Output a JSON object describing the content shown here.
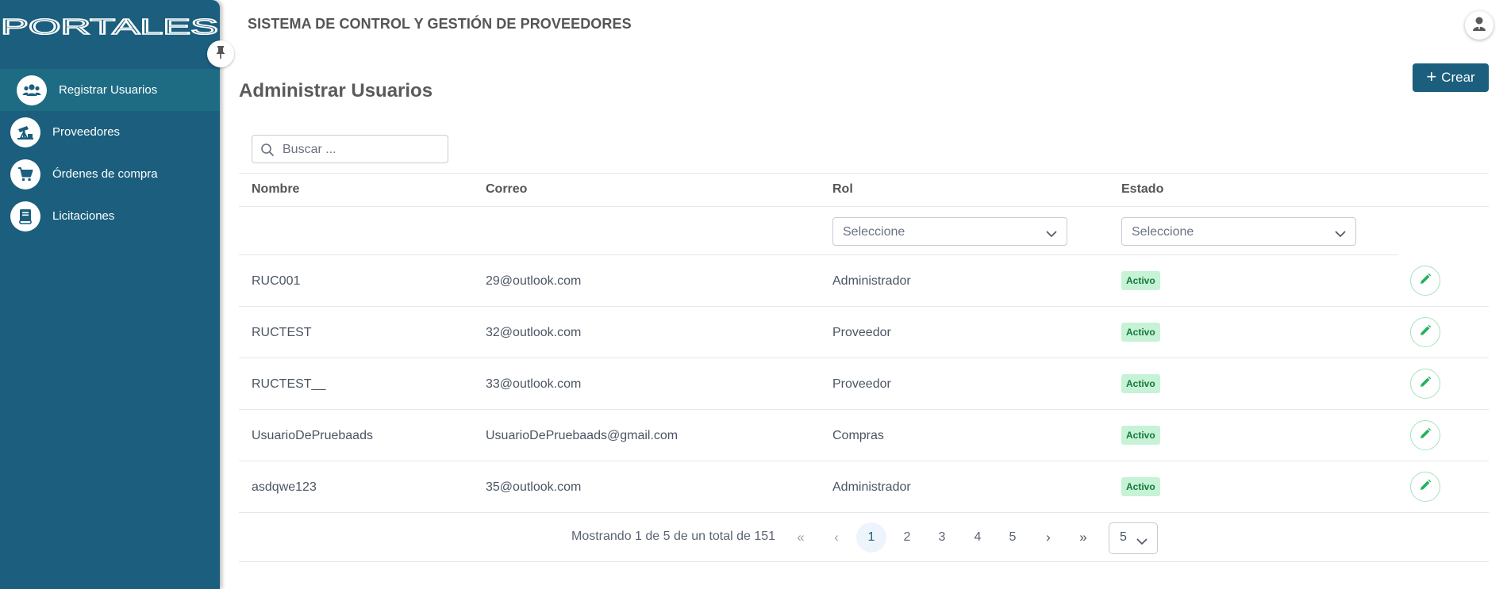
{
  "app": {
    "logo_text": "PORTALES",
    "header_title": "SISTEMA DE CONTROL Y GESTIÓN DE PROVEEDORES"
  },
  "sidebar": {
    "items": [
      {
        "label": "Registrar Usuarios",
        "icon": "users-icon",
        "active": true
      },
      {
        "label": "Proveedores",
        "icon": "oil-pump-icon",
        "active": false
      },
      {
        "label": "Órdenes de compra",
        "icon": "cart-icon",
        "active": false
      },
      {
        "label": "Licitaciones",
        "icon": "book-icon",
        "active": false
      }
    ]
  },
  "page": {
    "title": "Administrar Usuarios",
    "create_label": "Crear"
  },
  "search": {
    "placeholder": "Buscar ..."
  },
  "table": {
    "columns": [
      "Nombre",
      "Correo",
      "Rol",
      "Estado"
    ],
    "filters": {
      "rol": "Seleccione",
      "estado": "Seleccione"
    },
    "rows": [
      {
        "nombre": "RUC001",
        "correo": "29@outlook.com",
        "rol": "Administrador",
        "estado": "Activo"
      },
      {
        "nombre": "RUCTEST",
        "correo": "32@outlook.com",
        "rol": "Proveedor",
        "estado": "Activo"
      },
      {
        "nombre": "RUCTEST__",
        "correo": "33@outlook.com",
        "rol": "Proveedor",
        "estado": "Activo"
      },
      {
        "nombre": "UsuarioDePruebaads",
        "correo": "UsuarioDePruebaads@gmail.com",
        "rol": "Compras",
        "estado": "Activo"
      },
      {
        "nombre": "asdqwe123",
        "correo": "35@outlook.com",
        "rol": "Administrador",
        "estado": "Activo"
      }
    ]
  },
  "pagination": {
    "info": "Mostrando 1 de 5 de un total de 151",
    "first": "«",
    "prev": "‹",
    "next": "›",
    "last": "»",
    "pages": [
      "1",
      "2",
      "3",
      "4",
      "5"
    ],
    "current_page": "1",
    "page_size": "5"
  },
  "colors": {
    "sidebar": "#1b5e7d",
    "primary": "#1b5e7d",
    "badge_bg": "#c6f2d6",
    "badge_text": "#16773d",
    "edit_icon": "#22b35a"
  }
}
